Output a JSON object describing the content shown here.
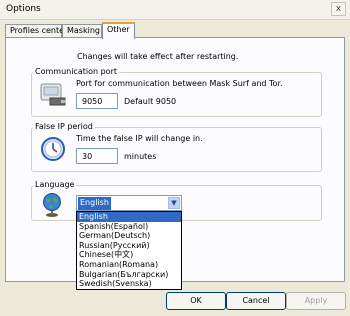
{
  "window": {
    "title": "Options",
    "close_label": "x"
  },
  "tabs": [
    {
      "label": "Profiles center"
    },
    {
      "label": "Masking"
    },
    {
      "label": "Other"
    }
  ],
  "notice": "Changes will take effect after restarting.",
  "communication_port": {
    "title": "Communication port",
    "description": "Port for communication between Mask Surf and Tor.",
    "port_value": "9050",
    "default_text": "Default 9050"
  },
  "false_ip": {
    "title": "False IP period",
    "description": "Time the false IP will change in.",
    "value": "30",
    "unit": "minutes"
  },
  "language": {
    "title": "Language",
    "selected": "English",
    "options": [
      "English",
      "Spanish(Español)",
      "German(Deutsch)",
      "Russian(Русский)",
      "Chinese(中文)",
      "Romanian(Romana)",
      "Bulgarian(Български)",
      "Swedish(Svenska)"
    ]
  },
  "buttons": {
    "ok": "OK",
    "cancel": "Cancel",
    "apply": "Apply"
  },
  "icons": {
    "port": "network-plug-icon",
    "period": "clock-icon",
    "language": "globe-icon"
  },
  "colors": {
    "highlight": "#316ac5",
    "active_tab_accent": "#e6a23c",
    "face": "#ece9d8"
  }
}
